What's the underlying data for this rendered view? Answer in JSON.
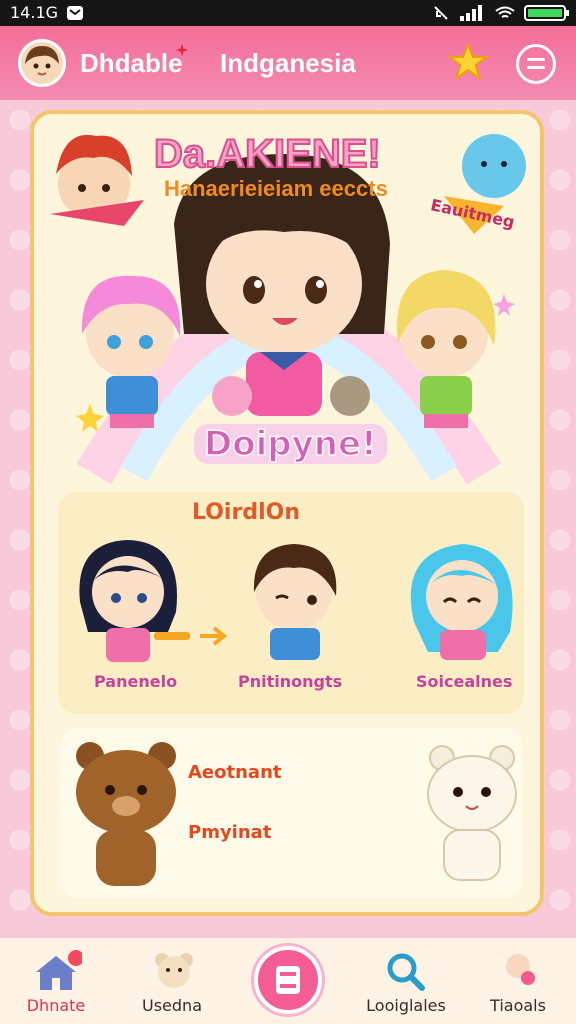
{
  "status_bar": {
    "time": "14.1G"
  },
  "header": {
    "left_title": "Dhdable",
    "right_title": "Indganesia"
  },
  "banner": {
    "title": "Da.AKIENE!",
    "subtitle": "Hanaerieieiam eeccts",
    "side_label": "Eauitmeg"
  },
  "hero": {
    "label": "Doipyne!"
  },
  "section": {
    "title": "LOirdlOn",
    "characters": [
      {
        "label": "Panenelo"
      },
      {
        "label": "Pnitinongts"
      },
      {
        "label": "Soicealnes"
      }
    ]
  },
  "bears": {
    "label_1": "Aeotnant",
    "label_2": "Pmyinat"
  },
  "bottom_nav": {
    "items": [
      {
        "label": "Dhnate"
      },
      {
        "label": "Usedna"
      },
      {
        "label": "Looiglales"
      },
      {
        "label": "Tiaoals"
      }
    ]
  },
  "colors": {
    "header": "#f56e9a",
    "card_border": "#f2c66d",
    "accent": "#f45e95"
  }
}
